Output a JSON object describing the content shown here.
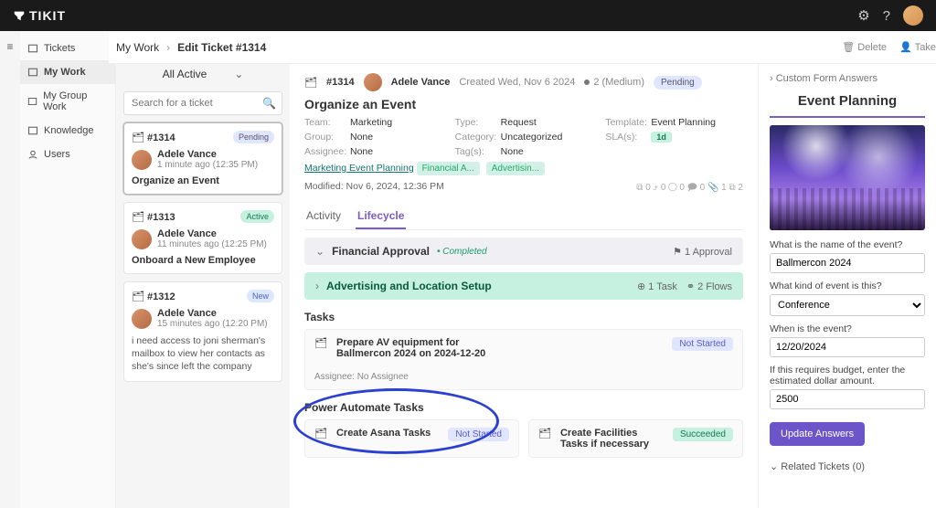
{
  "app": {
    "name": "TIKIT"
  },
  "topbar": {
    "settings_icon": "gear-icon",
    "help_icon": "help-icon"
  },
  "nav": {
    "items": [
      {
        "label": "Tickets"
      },
      {
        "label": "My Work"
      },
      {
        "label": "My Group Work"
      },
      {
        "label": "Knowledge"
      },
      {
        "label": "Users"
      }
    ]
  },
  "breadcrumb": {
    "root": "My Work",
    "current": "Edit Ticket #1314",
    "actions": {
      "delete": "Delete",
      "take": "Take"
    }
  },
  "midcol": {
    "filter": "All Active",
    "search_placeholder": "Search for a ticket",
    "cards": [
      {
        "id": "#1314",
        "status": "Pending",
        "status_cls": "pending",
        "avatar": "AV",
        "name": "Adele Vance",
        "meta": "1 minute ago (12:35 PM)",
        "title": "Organize an Event",
        "body": "",
        "selected": true
      },
      {
        "id": "#1313",
        "status": "Active",
        "status_cls": "active",
        "avatar": "AV",
        "name": "Adele Vance",
        "meta": "11 minutes ago (12:25 PM)",
        "title": "Onboard a New Employee",
        "body": ""
      },
      {
        "id": "#1312",
        "status": "New",
        "status_cls": "new",
        "avatar": "AV",
        "name": "Adele Vance",
        "meta": "15 minutes ago (12:20 PM)",
        "title": "",
        "body": "i need access to joni sherman's mailbox to view her contacts as she's since left the company"
      }
    ]
  },
  "ticket": {
    "id": "#1314",
    "requester": "Adele Vance",
    "created_label": "Created Wed, Nov 6 2024",
    "priority": "2 (Medium)",
    "status": "Pending",
    "title": "Organize an Event",
    "fields": {
      "team_label": "Team:",
      "team": "Marketing",
      "group_label": "Group:",
      "group": "None",
      "assignee_label": "Assignee:",
      "assignee": "None",
      "type_label": "Type:",
      "type": "Request",
      "category_label": "Category:",
      "category": "Uncategorized",
      "tags_label": "Tag(s):",
      "tags": "None",
      "template_label": "Template:",
      "template": "Event Planning",
      "sla_label": "SLA(s):",
      "sla": "1d"
    },
    "template_link": "Marketing Event Planning",
    "tag1": "Financial A...",
    "tag2": "Advertisin...",
    "modified_label": "Modified:",
    "modified": "Nov 6, 2024, 12:36 PM",
    "stats": "⧉ 0 ⤴ 0 ◯ 0 🗩 0 📎 1 ⧉ 2"
  },
  "tabs": {
    "activity": "Activity",
    "lifecycle": "Lifecycle"
  },
  "phases": {
    "fin": {
      "title": "Financial Approval",
      "completed": "• Completed",
      "right": "⚑ 1 Approval"
    },
    "adv": {
      "title": "Advertising and Location Setup",
      "right_tasks": "⊕ 1 Task",
      "right_flows": "⚭ 2 Flows"
    }
  },
  "tasks": {
    "heading": "Tasks",
    "prep": {
      "line1": "Prepare AV equipment for",
      "line2": "Ballmercon 2024 on 2024-12-20",
      "status": "Not Started"
    },
    "assignee_label": "Assignee:",
    "no_assignee": "No Assignee",
    "pa_heading": "Power Automate Tasks",
    "asana": {
      "title": "Create Asana Tasks",
      "status": "Not Started"
    },
    "fac": {
      "title": "Create Facilities Tasks if necessary",
      "status": "Succeeded"
    }
  },
  "rightpanel": {
    "custom_answers": "Custom Form Answers",
    "heading": "Event Planning",
    "q1": "What is the name of the event?",
    "a1": "Ballmercon 2024",
    "q2": "What kind of event is this?",
    "a2": "Conference",
    "q3": "When is the event?",
    "a3": "12/20/2024",
    "q4": "If this requires budget, enter the estimated dollar amount.",
    "a4": "2500",
    "button": "Update Answers",
    "related": "Related Tickets (0)"
  }
}
